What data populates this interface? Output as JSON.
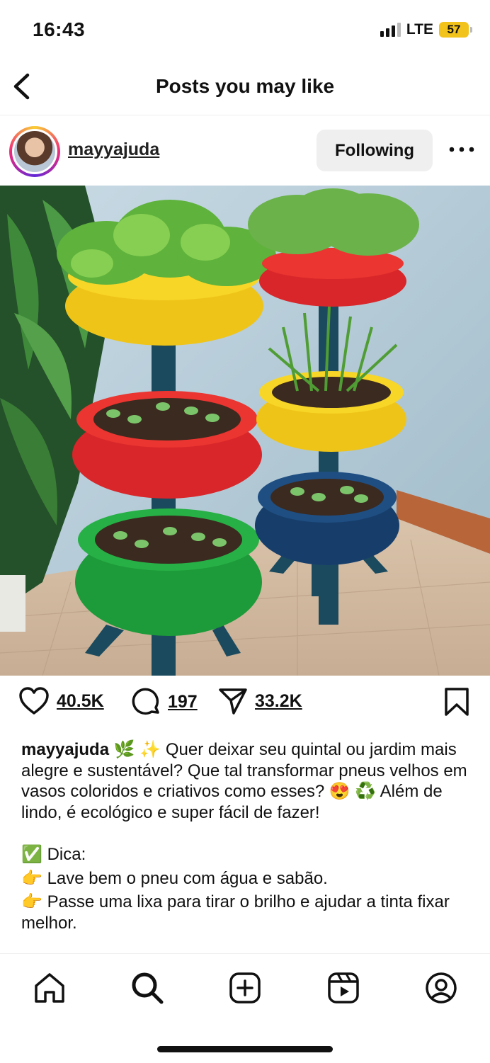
{
  "status_bar": {
    "time": "16:43",
    "network": "LTE",
    "battery": "57"
  },
  "header": {
    "title": "Posts you may like",
    "back_icon": "chevron-left-icon"
  },
  "post": {
    "username": "mayyajuda",
    "follow_label": "Following",
    "more_icon": "more-horizontal-icon",
    "image_icon": "tire-planters-photo",
    "likes": "40.5K",
    "comments": "197",
    "shares": "33.2K",
    "caption": {
      "username": "mayyajuda",
      "emoji_1": "🌿 ✨",
      "text_1": "Quer deixar seu quintal ou jardim mais alegre e sustentável? Que tal transformar pneus velhos em vasos coloridos e criativos como esses?",
      "emoji_2": "😍 ♻️",
      "text_2": "Além de lindo, é ecológico e super fácil de fazer!",
      "tip_emoji": "✅",
      "tip_title": "Dica:",
      "bullet_emoji": "👉",
      "tip_1": "Lave bem o pneu com água e sabão.",
      "tip_2": "Passe uma lixa para tirar o brilho e ajudar a tinta fixar melhor."
    }
  },
  "tab_bar": {
    "items": [
      "home-icon",
      "search-icon",
      "create-icon",
      "reels-icon",
      "profile-icon"
    ]
  },
  "colors": {
    "accent_red": "#e3262a",
    "tire_yellow": "#f4cf1a",
    "tire_green": "#1fa33a",
    "tire_blue": "#173e6b"
  }
}
